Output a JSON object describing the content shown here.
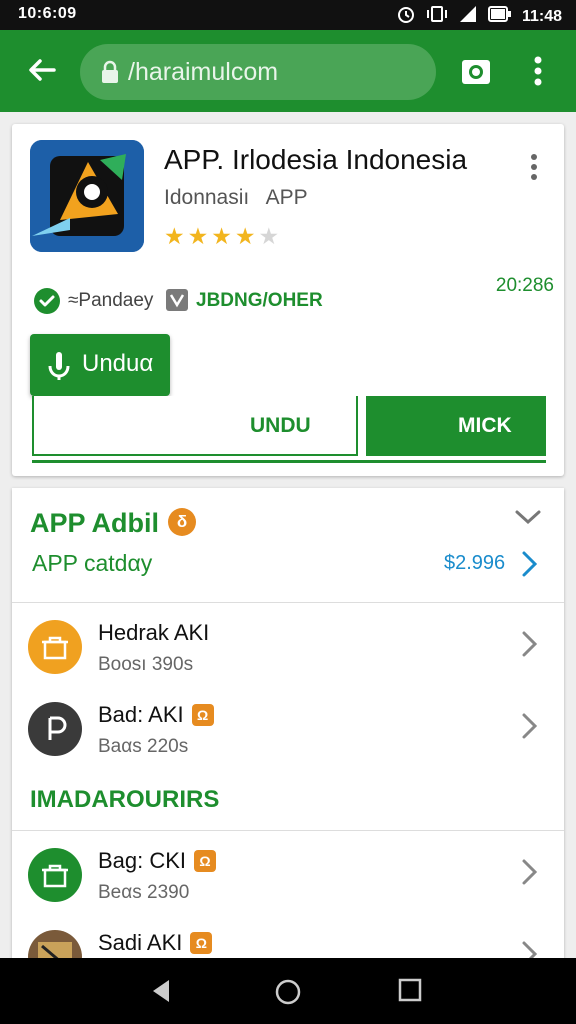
{
  "status_bar": {
    "time": "10:6:09",
    "clock_right": "11:48",
    "icons": [
      "alarm-icon",
      "vibrate-icon",
      "signal-icon",
      "battery-icon"
    ]
  },
  "browser": {
    "url": "/haraimulcom",
    "icons": [
      "back-arrow-icon",
      "lock-icon",
      "camera-icon",
      "kebab-menu-icon"
    ]
  },
  "app": {
    "title": "APP. Irlodesia Indonesia",
    "subtitle": "Idonnasiı   APP",
    "rating_stars": 4,
    "rating_max": 5,
    "developer": "≈Pandaey",
    "publisher": "JBDNG/OHER",
    "version": "20:286",
    "download_button": "Unduα",
    "button_outline": "UNDU",
    "button_solid": "MICK"
  },
  "section": {
    "title": "APP Adbil",
    "badge": "δ",
    "subtitle": "APP catdαy",
    "price": "$2.996"
  },
  "items": [
    {
      "name": "Hedrak AKI",
      "meta": "Boosı 390s",
      "icon_color": "#f0a120",
      "badge": ""
    },
    {
      "name": "Bad: AKI",
      "meta": "Baαs 220s",
      "icon_color": "#3a3a3a",
      "badge": "Ω"
    }
  ],
  "category_label": "IMADAROURIRS",
  "items2": [
    {
      "name": "Bag: CKI",
      "meta": "Beαs 2390",
      "icon_color": "#1e8e2e",
      "badge": "Ω"
    },
    {
      "name": "Sadi AKI",
      "meta": "",
      "icon_color": "#7a5a3a",
      "badge": "Ω"
    }
  ],
  "colors": {
    "brand_green": "#1e8e2e",
    "accent_orange": "#e68b20",
    "link_blue": "#1a8ccc"
  }
}
